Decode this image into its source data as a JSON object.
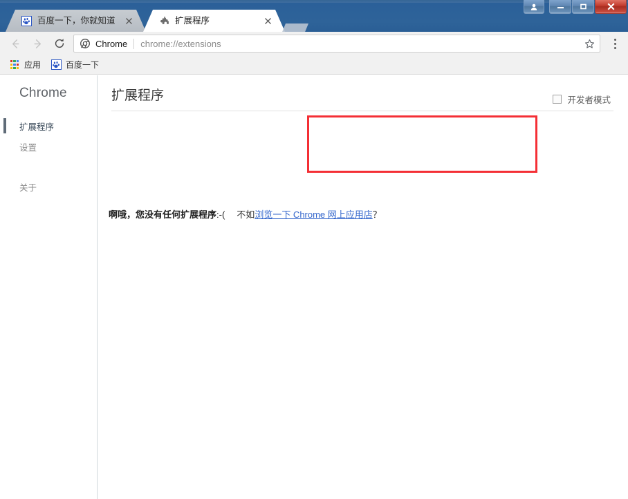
{
  "window": {
    "controls": {
      "avatar_label": "用户",
      "minimize_label": "最小化",
      "maximize_label": "最大化",
      "close_label": "关闭"
    }
  },
  "tabs": [
    {
      "title": "百度一下，你就知道",
      "favicon": "baidu-paw-icon",
      "active": false,
      "close_label": "×"
    },
    {
      "title": "扩展程序",
      "favicon": "puzzle-piece-icon",
      "active": true,
      "close_label": "×"
    }
  ],
  "newtab": {
    "label": "新建标签页"
  },
  "toolbar": {
    "back_label": "后退",
    "forward_label": "前进",
    "reload_label": "重新加载",
    "omnibox": {
      "scheme_label": "Chrome",
      "url": "chrome://extensions",
      "icon": "chrome-logo-icon",
      "star_label": "收藏此标签页"
    },
    "menu_label": "自定义及控制 Google Chrome"
  },
  "bookmarks": [
    {
      "label": "应用",
      "icon": "apps-grid-icon"
    },
    {
      "label": "百度一下",
      "icon": "baidu-paw-icon"
    }
  ],
  "sidebar": {
    "title": "Chrome",
    "items": [
      {
        "label": "扩展程序",
        "selected": true
      },
      {
        "label": "设置",
        "selected": false
      },
      {
        "label": "关于",
        "selected": false
      }
    ]
  },
  "main": {
    "page_title": "扩展程序",
    "developer_mode": {
      "label": "开发者模式",
      "checked": false
    },
    "empty_state": {
      "headline": "啊哦，您没有任何扩展程序",
      "emoticon": ":-(",
      "suggest_prefix": "不如",
      "link_text": "浏览一下 Chrome 网上应用店",
      "suggest_suffix": "？"
    }
  },
  "annotation": {
    "color": "#f42f35",
    "shape": "rectangle"
  }
}
